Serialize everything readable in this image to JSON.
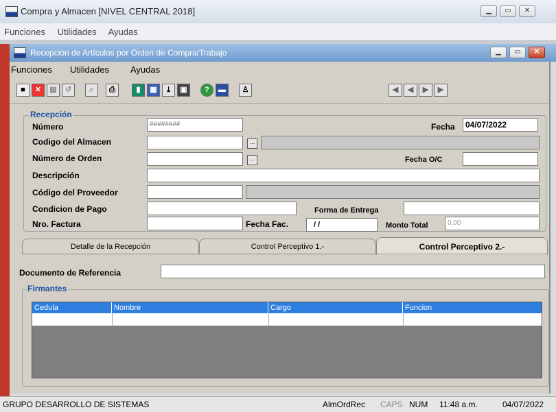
{
  "outer_window": {
    "title": "Compra y Almacen [NIVEL CENTRAL 2018]",
    "menu": [
      "Funciones",
      "Utilidades",
      "Ayudas"
    ]
  },
  "inner_window": {
    "title": "Recepción de Artículos por Orden de Compra/Trabajo",
    "menu": [
      "Funciones",
      "Utilidades",
      "Ayudas"
    ]
  },
  "toolbar": {
    "icons": [
      "save-icon",
      "cancel-icon",
      "print-preview-icon",
      "undo-icon",
      "search-icon",
      "printer-icon",
      "exit-icon",
      "calendar-icon",
      "export-icon",
      "image-icon",
      "help-icon",
      "form-icon",
      "user-icon"
    ],
    "nav_icons": [
      "first-record-icon",
      "previous-record-icon",
      "next-record-icon",
      "last-record-icon"
    ]
  },
  "recepcion": {
    "group_label": "Recepción",
    "numero_label": "Número",
    "numero_value": "########",
    "fecha_label": "Fecha",
    "fecha_value": "04/07/2022",
    "codigo_almacen_label": "Codigo del Almacen",
    "numero_orden_label": "Número de Orden",
    "fecha_oc_label": "Fecha O/C",
    "descripcion_label": "Descripción",
    "codigo_proveedor_label": "Código del  Proveedor",
    "condicion_pago_label": "Condicion de Pago",
    "forma_entrega_label": "Forma de Entrega",
    "nro_factura_label": "Nro. Factura",
    "fecha_fac_label": "Fecha Fac.",
    "fecha_fac_value": "/ /",
    "monto_total_label": "Monto Total",
    "monto_total_value": "0.00",
    "lookup_label": "..."
  },
  "tabs": [
    "Detalle de la Recepción",
    "Control Perceptivo 1.-",
    "Control Perceptivo 2.-"
  ],
  "active_tab": "Control Perceptivo 2.-",
  "documento_referencia_label": "Documento de Referencia",
  "firmantes": {
    "group_label": "Firmantes",
    "columns": [
      "Cedula",
      "Nombre",
      "Cargo",
      "Funcion"
    ]
  },
  "status_bar": {
    "company": "GRUPO DESARROLLO DE SISTEMAS",
    "module": "AlmOrdRec",
    "caps": "CAPS",
    "num": "NUM",
    "time": "11:48 a.m.",
    "date": "04/07/2022"
  },
  "colors": {
    "grid_header": "#2f7fe0",
    "inner_title": "#7aa4d6",
    "group_label": "#2050a0"
  }
}
